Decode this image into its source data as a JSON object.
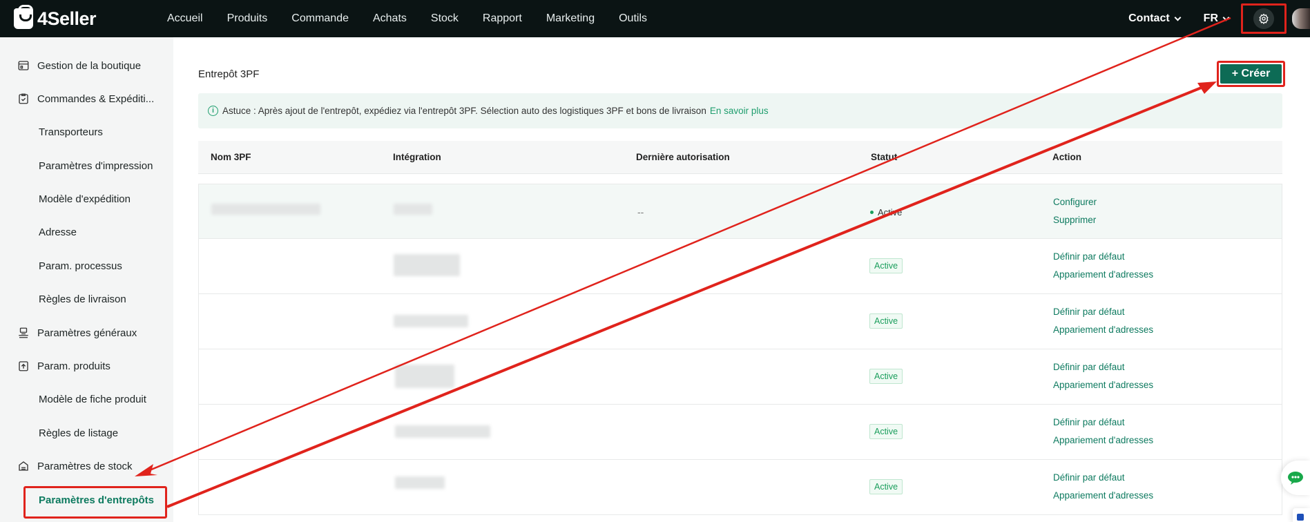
{
  "topbar": {
    "logo_text": "4Seller",
    "nav": [
      "Accueil",
      "Produits",
      "Commande",
      "Achats",
      "Stock",
      "Rapport",
      "Marketing",
      "Outils"
    ],
    "contact_label": "Contact",
    "lang_label": "FR"
  },
  "sidebar": {
    "items": [
      {
        "label": "Gestion de la boutique",
        "level": "parent",
        "icon": "shop-icon"
      },
      {
        "label": "Commandes & Expéditi...",
        "level": "parent",
        "icon": "clipboard-icon"
      },
      {
        "label": "Transporteurs",
        "level": "child"
      },
      {
        "label": "Paramètres d'impression",
        "level": "child"
      },
      {
        "label": "Modèle d'expédition",
        "level": "child"
      },
      {
        "label": "Adresse",
        "level": "child"
      },
      {
        "label": "Param. processus",
        "level": "child"
      },
      {
        "label": "Règles de livraison",
        "level": "child"
      },
      {
        "label": "Paramètres généraux",
        "level": "parent",
        "icon": "printer-icon"
      },
      {
        "label": "Param. produits",
        "level": "parent",
        "icon": "upload-box-icon"
      },
      {
        "label": "Modèle de fiche produit",
        "level": "child"
      },
      {
        "label": "Règles de listage",
        "level": "child"
      },
      {
        "label": "Paramètres de stock",
        "level": "parent",
        "icon": "warehouse-icon"
      },
      {
        "label": "Paramètres d'entrepôts",
        "level": "child",
        "active": true
      }
    ]
  },
  "main": {
    "title": "Entrepôt 3PF",
    "create_label": "+ Créer",
    "tip_text": "Astuce : Après ajout de l'entrepôt, expédiez via l'entrepôt 3PF. Sélection auto des logistiques 3PF et bons de livraison",
    "tip_link": "En savoir plus",
    "columns": [
      "Nom 3PF",
      "Intégration",
      "Dernière autorisation",
      "Statut",
      "Action"
    ],
    "rows": [
      {
        "last_auth": "--",
        "status": "Activé",
        "status_style": "dot",
        "actions": [
          "Configurer",
          "Supprimer"
        ]
      },
      {
        "last_auth": "",
        "status": "Active",
        "status_style": "badge",
        "actions": [
          "Définir par défaut",
          "Appariement d'adresses"
        ]
      },
      {
        "last_auth": "",
        "status": "Active",
        "status_style": "badge",
        "actions": [
          "Définir par défaut",
          "Appariement d'adresses"
        ]
      },
      {
        "last_auth": "",
        "status": "Active",
        "status_style": "badge",
        "actions": [
          "Définir par défaut",
          "Appariement d'adresses"
        ]
      },
      {
        "last_auth": "",
        "status": "Active",
        "status_style": "badge",
        "actions": [
          "Définir par défaut",
          "Appariement d'adresses"
        ]
      },
      {
        "last_auth": "",
        "status": "Active",
        "status_style": "badge",
        "actions": [
          "Définir par défaut",
          "Appariement d'adresses"
        ]
      }
    ]
  },
  "colors": {
    "topbar_bg": "#0b1414",
    "accent": "#0d7a5f",
    "annotation": "#e0231c",
    "status_green": "#1a9e5c"
  }
}
